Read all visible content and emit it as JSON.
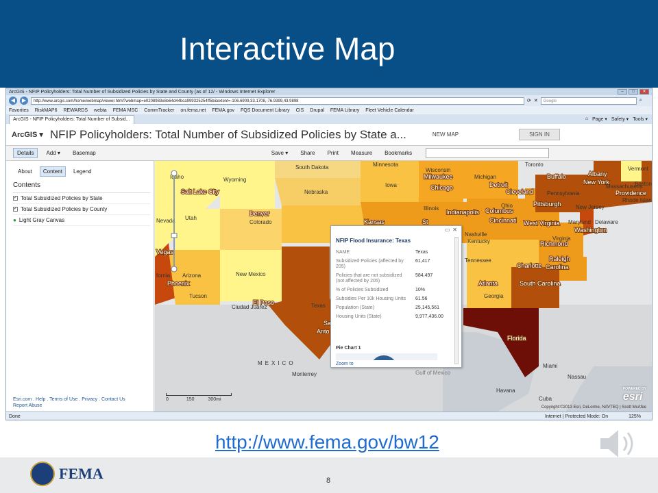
{
  "slide": {
    "title": "Interactive Map",
    "link": "http://www.fema.gov/bw12",
    "page_number": "8",
    "logo_text": "FEMA"
  },
  "browser": {
    "window_title": "ArcGIS - NFIP Policyholders: Total Number of Subsidized Policies by State and County (as of 12/ - Windows Internet Explorer",
    "address": "http://www.arcgis.com/home/webmap/viewer.html?webmap=e0208983e8e64d44bca999325254ff5b&extent=-106.6909,33.1708,-76.9399,43.9898",
    "search_placeholder": "Google",
    "favorites": [
      "Favorites",
      "RiskMAP6",
      "REWARDS",
      "webta",
      "FEMA MSC",
      "CommTracker",
      "on.fema.net",
      "FEMA.gov",
      "FQS Document Library",
      "CIS",
      "Drupal",
      "FEMA Library",
      "Fleet Vehicle Calendar"
    ],
    "tab_title": "ArcGIS - NFIP Policyholders: Total Number of Subsid...",
    "command_items": [
      "Page ▾",
      "Safety ▾",
      "Tools ▾"
    ],
    "status_left": "Done",
    "status_zone": "Internet | Protected Mode: On",
    "zoom_level": "125%"
  },
  "arcgis": {
    "logo": "ArcGIS ▾",
    "map_title": "NFIP Policyholders: Total Number of Subsidized Policies by State a...",
    "new_map": "NEW MAP",
    "sign_in": "SIGN IN",
    "toolbar_left": [
      "Details",
      "Add ▾",
      "Basemap"
    ],
    "toolbar_right": [
      "Save ▾",
      "Share",
      "Print",
      "Measure",
      "Bookmarks"
    ],
    "panel_tabs": [
      "About",
      "Content",
      "Legend"
    ],
    "contents_heading": "Contents",
    "layers": [
      "Total Subsidized Policies by State",
      "Total Subsidized Policies by County",
      "Light Gray Canvas"
    ],
    "footer_links": "Esri.com . Help . Terms of Use . Privacy . Contact Us",
    "footer_links2": "Report Abuse"
  },
  "popup": {
    "title": "NFIP Flood Insurance: Texas",
    "rows": [
      {
        "label": "NAME",
        "value": "Texas"
      },
      {
        "label": "Subsidized Policies (affected by 205)",
        "value": "61,417"
      },
      {
        "label": "Policies that are not subsidized (not affected by 205)",
        "value": "584,497"
      },
      {
        "label": "% of Policies Subsidized",
        "value": "10%"
      },
      {
        "label": "Subsidies Per 10k Housing Units",
        "value": "61.56"
      },
      {
        "label": "Population (State)",
        "value": "25,145,561"
      },
      {
        "label": "Housing Units (State)",
        "value": "9,977,436.00"
      }
    ],
    "chart_title": "Pie Chart 1",
    "zoom_link": "Zoom to"
  },
  "map": {
    "labels": [
      "South Dakota",
      "Minnesota",
      "Wisconsin",
      "Milwaukee",
      "Michigan",
      "Detroit",
      "Toronto",
      "Buffalo",
      "New York",
      "Vermont",
      "Boston",
      "Massachusetts",
      "Providence",
      "Rhode Island",
      "Wyoming",
      "Nebraska",
      "Iowa",
      "Chicago",
      "Cleveland",
      "Pennsylvania",
      "Pittsburgh",
      "New Jersey",
      "Salt Lake City",
      "Utah",
      "Nevada",
      "Denver",
      "Colorado",
      "Kansas",
      "Illinois",
      "Indianapolis",
      "Ohio",
      "Columbus",
      "Cincinnati",
      "West Virginia",
      "Virginia",
      "Maryland",
      "Delaware",
      "Washington",
      "Richmond",
      "New Mexico",
      "Arizona",
      "Phoenix",
      "Tucson",
      "Vegas",
      "fornia",
      "El Paso",
      "Ciudad Juárez",
      "Texas",
      "Tennessee",
      "Nashville",
      "Kentucky",
      "Charlotte",
      "Raleigh",
      "Carolina",
      "Atlanta",
      "Georgia",
      "South Carolina",
      "Florida",
      "Miami",
      "Nassau",
      "Havana",
      "Cuba",
      "MEXICO",
      "Monterrey",
      "Gulf of Mexico",
      "Idaho",
      "Albany",
      "Anto",
      "Sa",
      "St"
    ],
    "scale_labels": [
      "0",
      "150",
      "300mi"
    ],
    "attribution": "Copyright:©2013 Esri, DeLorme, NAVTEQ | Scott McAfee",
    "esri_logo": "esri",
    "powered_by": "POWERED BY"
  },
  "icons": [
    "back-arrow-icon",
    "forward-arrow-icon",
    "refresh-icon",
    "stop-icon",
    "search-icon",
    "home-icon",
    "speaker-icon"
  ],
  "colors": {
    "title_bar": "#084f87",
    "choropleth_light": "#fff58a",
    "choropleth_mid": "#f9c243",
    "choropleth_dark": "#b24f0b",
    "choropleth_darkest": "#6d0f07",
    "link": "#1f6bd0"
  }
}
